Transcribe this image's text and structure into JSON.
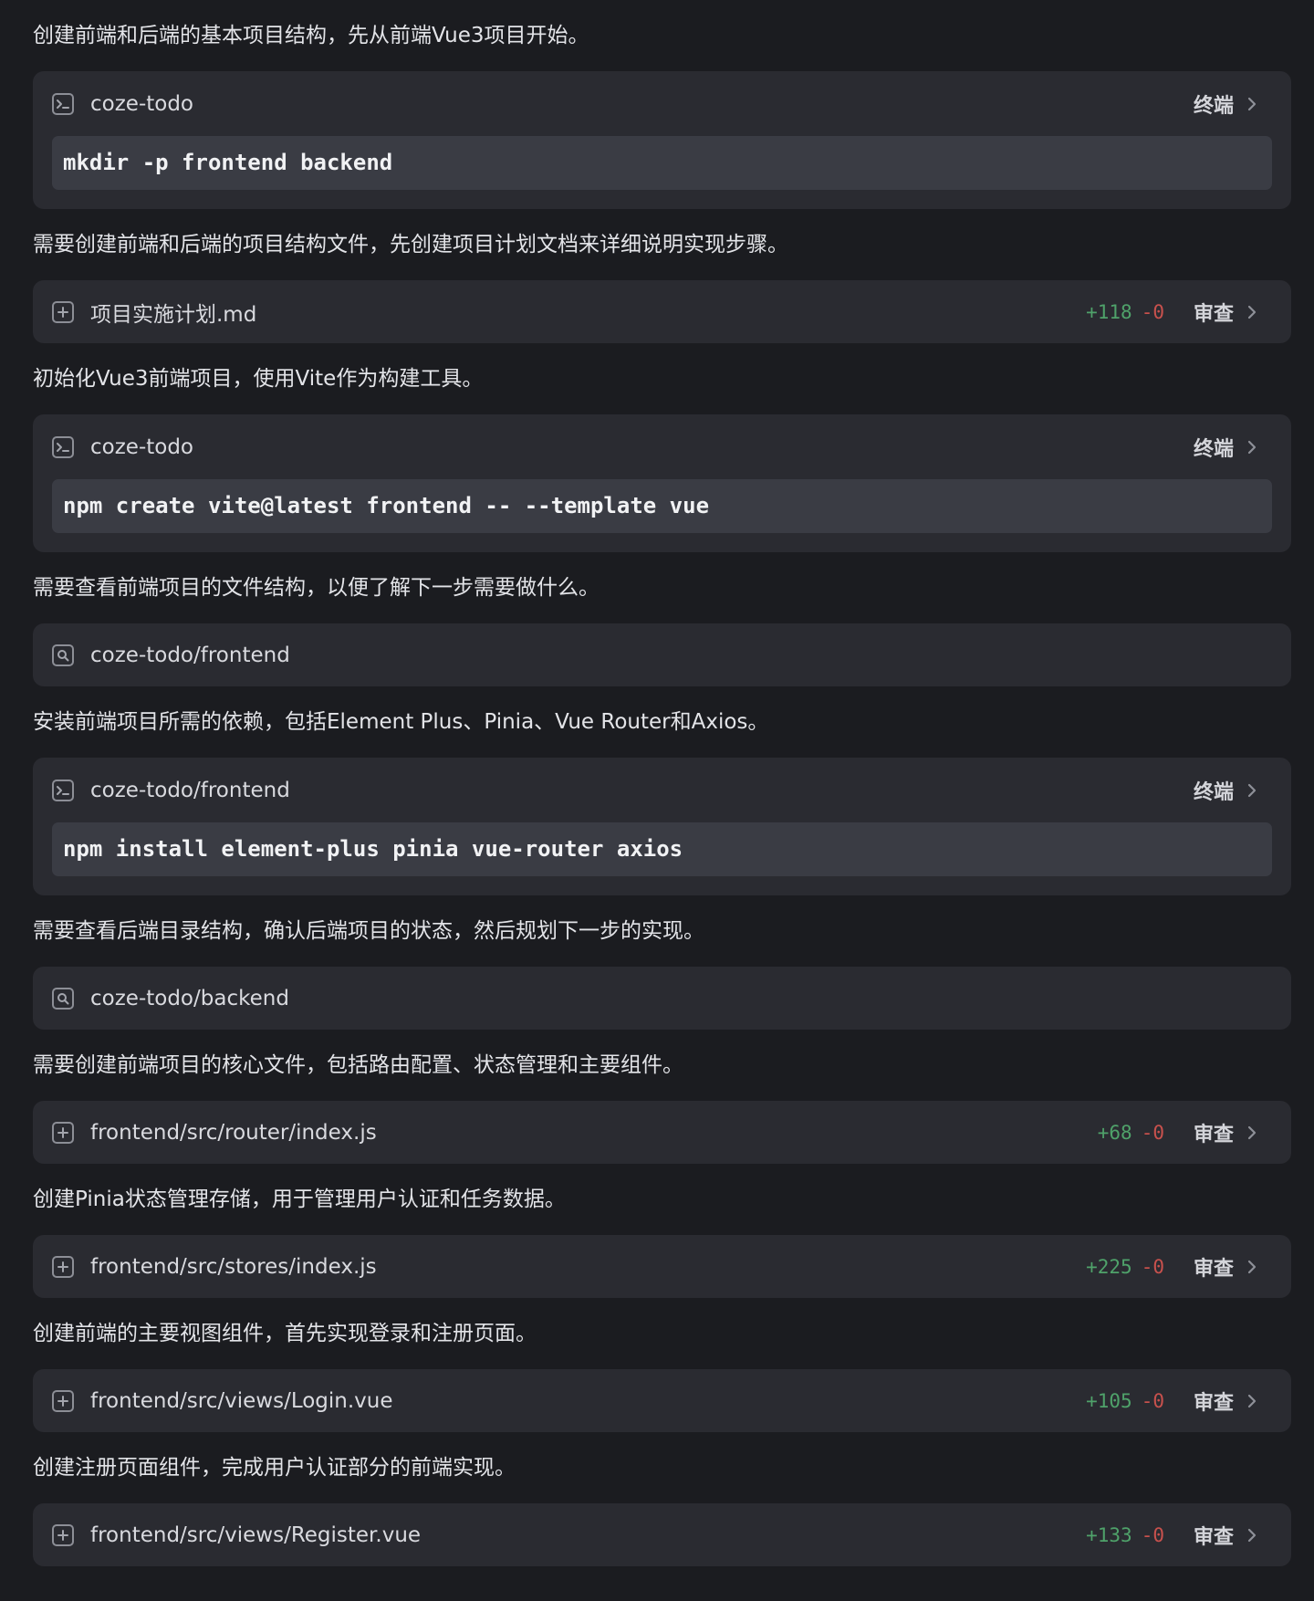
{
  "feed": [
    {
      "type": "message",
      "text": "创建前端和后端的基本项目结构，先从前端Vue3项目开始。"
    },
    {
      "type": "terminal",
      "icon": "terminal-icon",
      "title": "coze-todo",
      "action": "终端",
      "command": "mkdir -p frontend backend"
    },
    {
      "type": "message",
      "text": "需要创建前端和后端的项目结构文件，先创建项目计划文档来详细说明实现步骤。"
    },
    {
      "type": "file",
      "icon": "add-file-icon",
      "title": "项目实施计划.md",
      "added": "+118",
      "removed": "-0",
      "action": "审查"
    },
    {
      "type": "message",
      "text": "初始化Vue3前端项目，使用Vite作为构建工具。"
    },
    {
      "type": "terminal",
      "icon": "terminal-icon",
      "title": "coze-todo",
      "action": "终端",
      "command": "npm create vite@latest frontend -- --template vue"
    },
    {
      "type": "message",
      "text": "需要查看前端项目的文件结构，以便了解下一步需要做什么。"
    },
    {
      "type": "search",
      "icon": "search-icon",
      "title": "coze-todo/frontend"
    },
    {
      "type": "message",
      "text": "安装前端项目所需的依赖，包括Element Plus、Pinia、Vue Router和Axios。"
    },
    {
      "type": "terminal",
      "icon": "terminal-icon",
      "title": "coze-todo/frontend",
      "action": "终端",
      "command": "npm install element-plus pinia vue-router axios"
    },
    {
      "type": "message",
      "text": "需要查看后端目录结构，确认后端项目的状态，然后规划下一步的实现。"
    },
    {
      "type": "search",
      "icon": "search-icon",
      "title": "coze-todo/backend"
    },
    {
      "type": "message",
      "text": "需要创建前端项目的核心文件，包括路由配置、状态管理和主要组件。"
    },
    {
      "type": "file",
      "icon": "add-file-icon",
      "title": "frontend/src/router/index.js",
      "added": "+68",
      "removed": "-0",
      "action": "审查"
    },
    {
      "type": "message",
      "text": "创建Pinia状态管理存储，用于管理用户认证和任务数据。"
    },
    {
      "type": "file",
      "icon": "add-file-icon",
      "title": "frontend/src/stores/index.js",
      "added": "+225",
      "removed": "-0",
      "action": "审查"
    },
    {
      "type": "message",
      "text": "创建前端的主要视图组件，首先实现登录和注册页面。"
    },
    {
      "type": "file",
      "icon": "add-file-icon",
      "title": "frontend/src/views/Login.vue",
      "added": "+105",
      "removed": "-0",
      "action": "审查"
    },
    {
      "type": "message",
      "text": "创建注册页面组件，完成用户认证部分的前端实现。"
    },
    {
      "type": "file",
      "icon": "add-file-icon",
      "title": "frontend/src/views/Register.vue",
      "added": "+133",
      "removed": "-0",
      "action": "审查"
    }
  ]
}
